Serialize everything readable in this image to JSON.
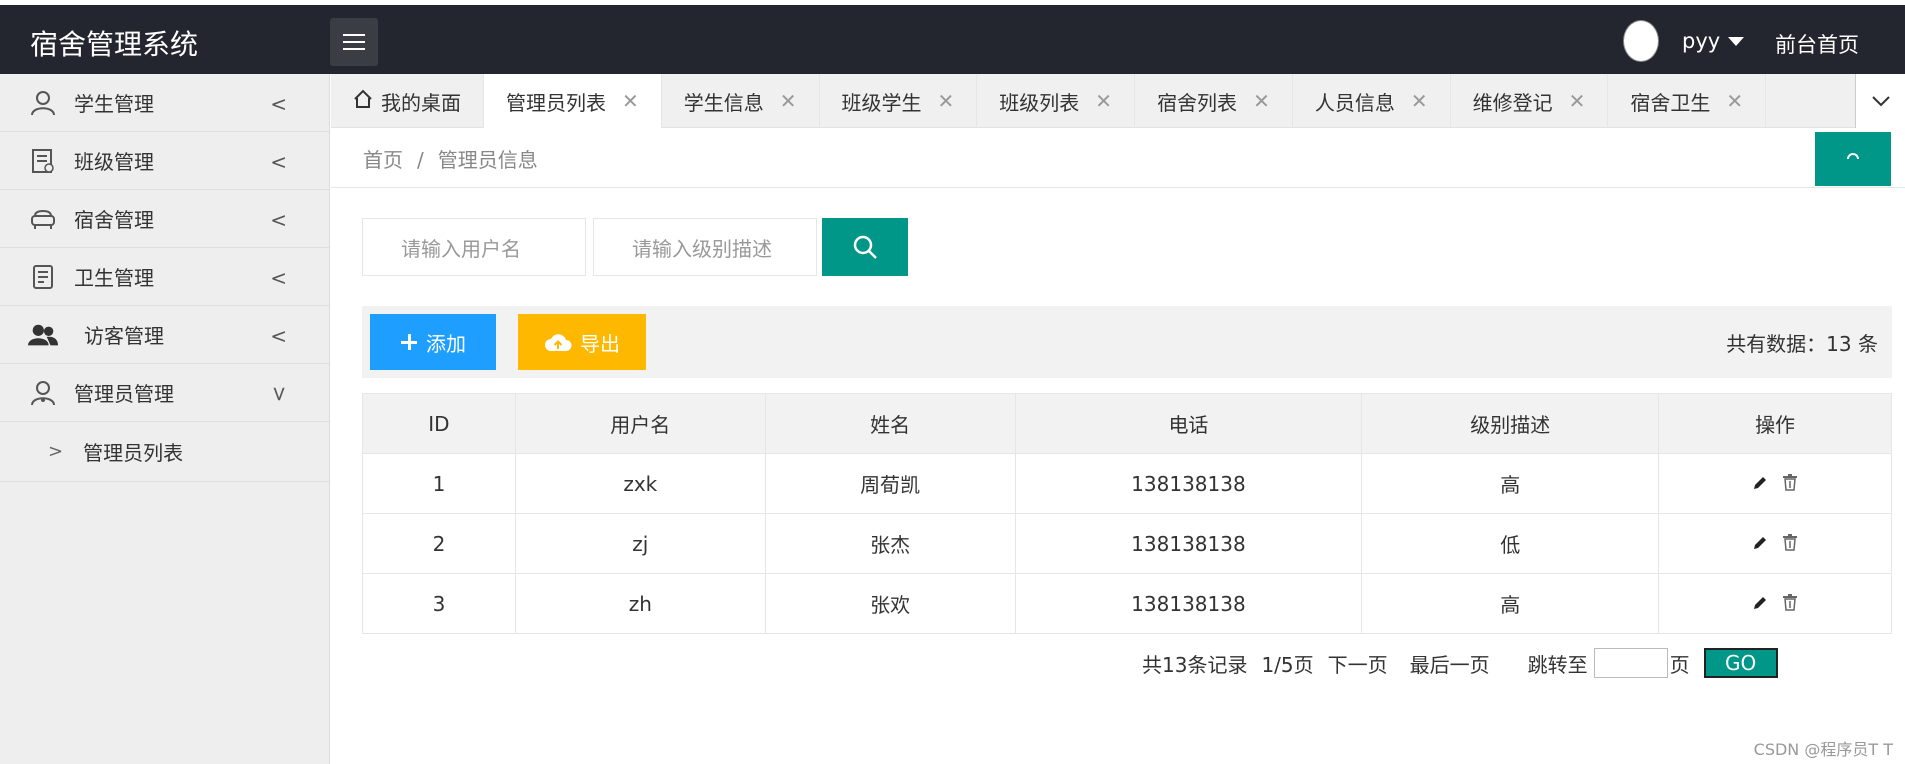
{
  "header": {
    "brand": "宿舍管理系统",
    "username": "pyy",
    "front_link": "前台首页"
  },
  "sidebar": {
    "items": [
      {
        "label": "学生管理",
        "icon": "user-icon"
      },
      {
        "label": "班级管理",
        "icon": "document-icon"
      },
      {
        "label": "宿舍管理",
        "icon": "sofa-icon"
      },
      {
        "label": "卫生管理",
        "icon": "clipboard-icon"
      },
      {
        "label": "访客管理",
        "icon": "users-icon"
      },
      {
        "label": "管理员管理",
        "icon": "admin-icon"
      }
    ],
    "sub_item": "管理员列表"
  },
  "tabs": [
    {
      "label": "我的桌面",
      "closable": false
    },
    {
      "label": "管理员列表",
      "closable": true,
      "active": true
    },
    {
      "label": "学生信息",
      "closable": true
    },
    {
      "label": "班级学生",
      "closable": true
    },
    {
      "label": "班级列表",
      "closable": true
    },
    {
      "label": "宿舍列表",
      "closable": true
    },
    {
      "label": "人员信息",
      "closable": true
    },
    {
      "label": "维修登记",
      "closable": true
    },
    {
      "label": "宿舍卫生",
      "closable": true
    }
  ],
  "breadcrumb": {
    "home": "首页",
    "sep": "/",
    "current": "管理员信息"
  },
  "search": {
    "username_placeholder": "请输入用户名",
    "level_placeholder": "请输入级别描述"
  },
  "toolbar": {
    "add_label": "添加",
    "export_label": "导出",
    "total_label": "共有数据：13 条"
  },
  "table": {
    "headers": [
      "ID",
      "用户名",
      "姓名",
      "电话",
      "级别描述",
      "操作"
    ],
    "rows": [
      {
        "id": "1",
        "username": "zxk",
        "name": "周荀凯",
        "phone": "138138138",
        "level": "高"
      },
      {
        "id": "2",
        "username": "zj",
        "name": "张杰",
        "phone": "138138138",
        "level": "低"
      },
      {
        "id": "3",
        "username": "zh",
        "name": "张欢",
        "phone": "138138138",
        "level": "高"
      }
    ]
  },
  "pagination": {
    "total": "共13条记录",
    "page": "1/5页",
    "next": "下一页",
    "last": "最后一页",
    "jump_prefix": "跳转至",
    "jump_suffix": "页",
    "go": "GO"
  },
  "watermark": "CSDN @程序员T T",
  "colors": {
    "primary": "#009688",
    "add": "#1e9fff",
    "export": "#ffb800",
    "header": "#23262e"
  }
}
